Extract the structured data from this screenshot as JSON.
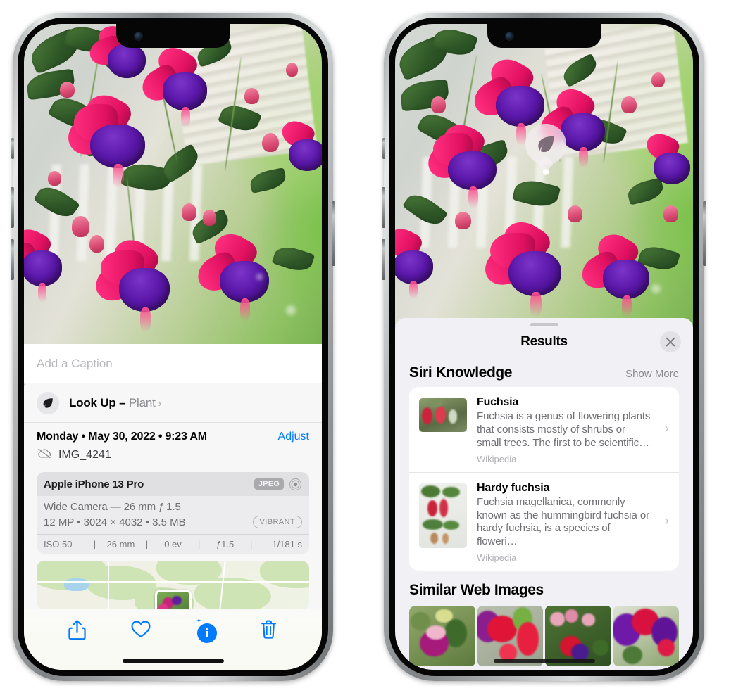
{
  "left_phone": {
    "name": "Photos app — photo info sheet",
    "caption": {
      "placeholder": "Add a Caption",
      "value": ""
    },
    "look_up": {
      "icon": "leaf-icon",
      "label": "Look Up – ",
      "subject": "Plant",
      "chevron": "›"
    },
    "metadata": {
      "date": "Monday • May 30, 2022 • 9:23 AM",
      "adjust_label": "Adjust",
      "cloud_icon": "cloud-slash-icon",
      "filename": "IMG_4241"
    },
    "exif": {
      "device": "Apple iPhone 13 Pro",
      "format_badge": "JPEG",
      "lens_icon": "lens-icon",
      "lens_line": "Wide Camera — 26 mm ƒ 1.5",
      "size_line": "12 MP • 3024 × 4032 • 3.5 MB",
      "style_badge": "VIBRANT",
      "settings": [
        "ISO 50",
        "26 mm",
        "0 ev",
        "ƒ1.5",
        "1/181 s"
      ]
    },
    "map": {
      "name": "location-map-thumbnail"
    },
    "toolbar": [
      {
        "name": "share-button",
        "icon": "share-icon",
        "active": false
      },
      {
        "name": "favorite-button",
        "icon": "heart-icon",
        "active": false
      },
      {
        "name": "info-button",
        "icon": "info-sparkle-icon",
        "active": true,
        "glyph": "i"
      },
      {
        "name": "delete-button",
        "icon": "trash-icon",
        "active": false
      }
    ]
  },
  "right_phone": {
    "name": "Photos app — Visual Look Up results",
    "visual_lookup_badge": {
      "icon": "leaf-icon",
      "label": "Visual Look Up"
    },
    "sheet": {
      "title": "Results",
      "close_icon": "close-icon",
      "sections": [
        {
          "title": "Siri Knowledge",
          "action": "Show More",
          "items": [
            {
              "title": "Fuchsia",
              "description": "Fuchsia is a genus of flowering plants that consists mostly of shrubs or small trees. The first to be scientific…",
              "source": "Wikipedia",
              "thumb": "fuchsia-red-flowers-thumbnail",
              "chevron": "›"
            },
            {
              "title": "Hardy fuchsia",
              "description": "Fuchsia magellanica, commonly known as the hummingbird fuchsia or hardy fuchsia, is a species of floweri…",
              "source": "Wikipedia",
              "thumb": "hardy-fuchsia-specimen-thumbnail",
              "chevron": "›"
            }
          ]
        },
        {
          "title": "Similar Web Images",
          "action": "",
          "thumbnails": [
            "fuchsia-pink-purple-leaves-thumbnail",
            "fuchsia-red-closeup-thumbnail",
            "fuchsia-shrub-buds-thumbnail",
            "fuchsia-purple-magenta-thumbnail"
          ]
        }
      ]
    }
  },
  "colors": {
    "accent_blue": "#007AFF",
    "sheet_bg": "#F1F1F5",
    "info_bg": "#F7F7F7",
    "card_bg": "#FFFFFF",
    "secondary_text": "#6E6E73",
    "tertiary_text": "#B0B0B5"
  }
}
